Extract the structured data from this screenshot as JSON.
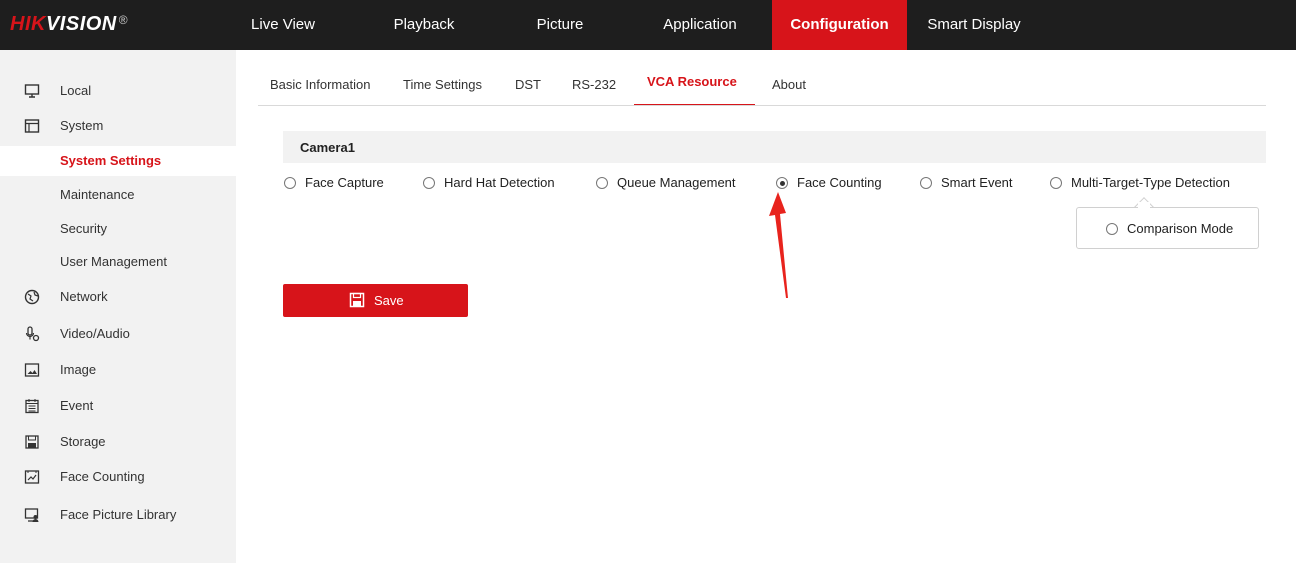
{
  "brand": {
    "accent": "HIK",
    "rest": "VISION",
    "reg": "®"
  },
  "nav": {
    "items": [
      "Live View",
      "Playback",
      "Picture",
      "Application",
      "Configuration",
      "Smart Display"
    ],
    "active": "Configuration",
    "accent_color": "#d7141a"
  },
  "sidebar": {
    "items": [
      {
        "label": "Local",
        "icon": "monitor-icon"
      },
      {
        "label": "System",
        "icon": "system-icon"
      },
      {
        "label": "System Settings",
        "sub": true,
        "active": true
      },
      {
        "label": "Maintenance",
        "sub": true
      },
      {
        "label": "Security",
        "sub": true
      },
      {
        "label": "User Management",
        "sub": true
      },
      {
        "label": "Network",
        "icon": "globe-icon"
      },
      {
        "label": "Video/Audio",
        "icon": "microphone-icon"
      },
      {
        "label": "Image",
        "icon": "image-icon"
      },
      {
        "label": "Event",
        "icon": "calendar-icon"
      },
      {
        "label": "Storage",
        "icon": "floppy-icon"
      },
      {
        "label": "Face Counting",
        "icon": "chart-icon"
      },
      {
        "label": "Face Picture Library",
        "icon": "face-library-icon"
      }
    ]
  },
  "tabs": {
    "items": [
      "Basic Information",
      "Time Settings",
      "DST",
      "RS-232",
      "VCA Resource",
      "About"
    ],
    "active": "VCA Resource"
  },
  "camera": {
    "title": "Camera1",
    "options": [
      "Face Capture",
      "Hard Hat Detection",
      "Queue Management",
      "Face Counting",
      "Smart Event",
      "Multi-Target-Type Detection"
    ],
    "selected": "Face Counting",
    "sub_option": "Comparison Mode"
  },
  "save": {
    "label": "Save"
  }
}
